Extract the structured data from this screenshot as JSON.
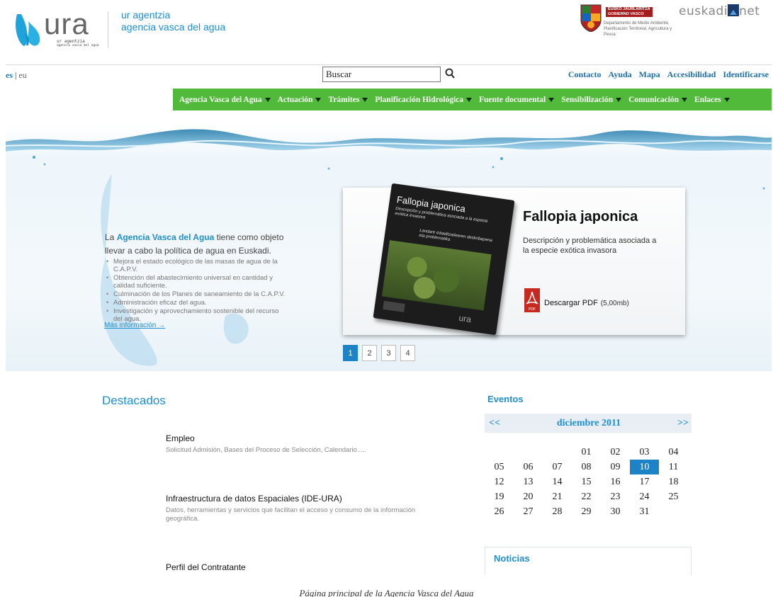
{
  "header": {
    "logo_word": "ura",
    "logo_sub_line1": "ur agentzia",
    "logo_sub_line2": "agencia vasca del agua",
    "site_name_line1": "ur agentzia",
    "site_name_line2": "agencia vasca del agua",
    "gov_name_line1": "EUSKO JAURLARITZA",
    "gov_name_line2": "GOBIERNO VASCO",
    "gov_dept": "Departamento de Medio Ambiente, Planificación Territorial, Agricultura y Pesca",
    "euskadi_left": "euskadi",
    "euskadi_right": "net"
  },
  "toolbar": {
    "lang_active": "es",
    "lang_separator": "|",
    "lang_other": "eu",
    "search_value": "Buscar",
    "top_links": [
      "Contacto",
      "Ayuda",
      "Mapa",
      "Accesibilidad",
      "Identificarse"
    ]
  },
  "nav": {
    "items": [
      "Agencia Vasca del Agua",
      "Actuación",
      "Trámites",
      "Planificación Hidrológica",
      "Fuente documental",
      "Sensibilización",
      "Comunicación",
      "Enlaces"
    ]
  },
  "hero": {
    "intro_prefix": "La ",
    "intro_highlight": "Agencia Vasca del Agua",
    "intro_suffix": " tiene como objeto llevar a cabo la política de agua en Euskadi.",
    "bullets": [
      "Mejora el estado ecológico de las masas de agua de la C.A.P.V.",
      "Obtención del abastecimiento universal en cantidad y calidad suficiente.",
      "Culminación de los Planes de saneamiento de la C.A.P.V.",
      "Administración eficaz del agua.",
      "Investigación y aprovechamiento sostenible del recurso del agua."
    ],
    "more_link": "Más información →",
    "card": {
      "book_title": "Fallopia japonica",
      "book_subtitle": "Descripción y problemática asociada a la especie exótica invasora",
      "book_subtitle_eu": "Landare inbaditzailearen deskribapena eta problematika",
      "book_brand": "ura",
      "title": "Fallopia japonica",
      "description": "Descripción y problemática asociada a la especie exótica invasora",
      "download_label": "Descargar PDF",
      "download_size": "(5,00mb)",
      "pdf_badge": "PDF"
    },
    "pager": [
      "1",
      "2",
      "3",
      "4"
    ],
    "pager_active": 0
  },
  "destacados": {
    "title": "Destacados",
    "items": [
      {
        "title": "Empleo",
        "desc": "Solicitud Admisión, Bases del Proceso de Selección, Calendario....."
      },
      {
        "title": "Infraestructura de datos Espaciales (IDE-URA)",
        "desc": "Datos, herramientas y servicios que facilitan el acceso y consumo de la información geográfica."
      },
      {
        "title": "Perfil del Contratante",
        "desc": ""
      }
    ]
  },
  "eventos": {
    "title": "Eventos",
    "prev": "<<",
    "next": ">>",
    "month": "diciembre 2011",
    "days": [
      "",
      "",
      "",
      "01",
      "02",
      "03",
      "04",
      "05",
      "06",
      "07",
      "08",
      "09",
      "10",
      "11",
      "12",
      "13",
      "14",
      "15",
      "16",
      "17",
      "18",
      "19",
      "20",
      "21",
      "22",
      "23",
      "24",
      "25",
      "26",
      "27",
      "28",
      "29",
      "30",
      "31"
    ],
    "today": "10"
  },
  "noticias": {
    "title": "Noticias"
  },
  "caption": "Página principal de la Agencia Vasca del Agua",
  "colors": {
    "accent": "#1f8fce",
    "nav_green": "#52ba3a",
    "today": "#1d82c6"
  }
}
